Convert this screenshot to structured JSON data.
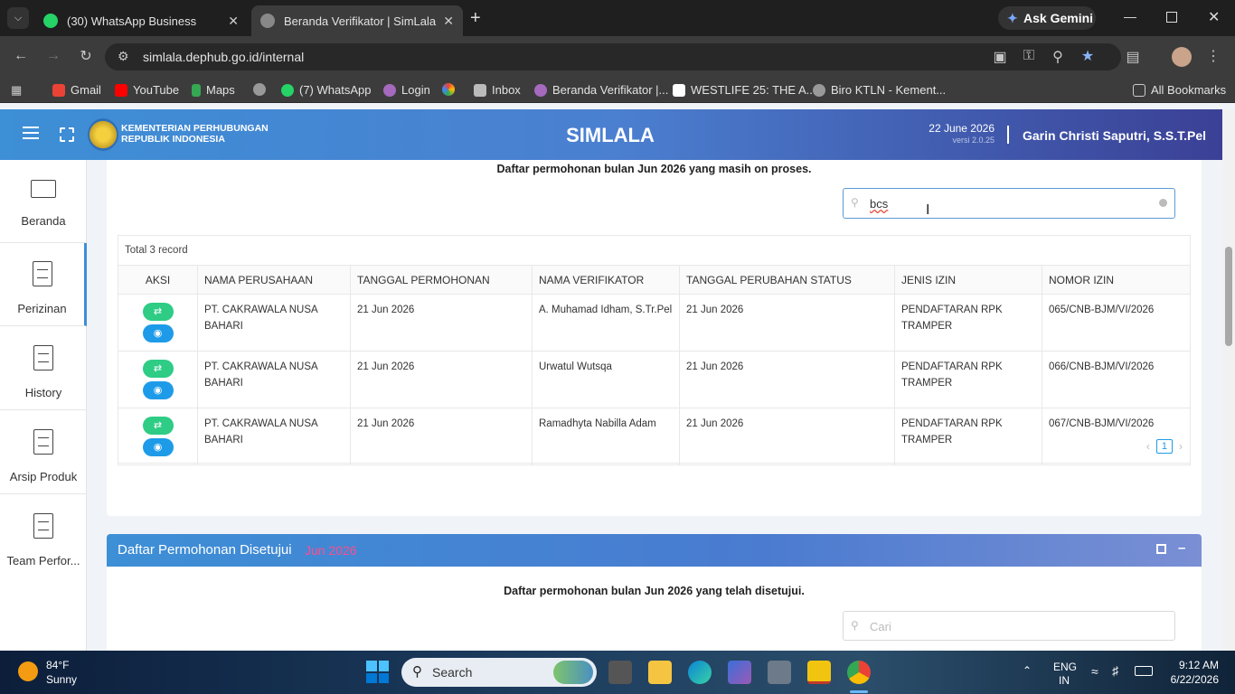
{
  "browser": {
    "tabs": [
      {
        "title": "(30) WhatsApp Business"
      },
      {
        "title": "Beranda Verifikator | SimLala"
      }
    ],
    "url": "simlala.dephub.go.id/internal",
    "ask_gemini": "Ask Gemini",
    "bookmarks": [
      "Gmail",
      "YouTube",
      "Maps",
      "(7) WhatsApp",
      "Login",
      "Inbox",
      "Beranda Verifikator |...",
      "WESTLIFE 25: THE A...",
      "Biro KTLN - Kement..."
    ],
    "all_bookmarks": "All Bookmarks"
  },
  "header": {
    "org_line1": "KEMENTERIAN PERHUBUNGAN",
    "org_line2": "REPUBLIK INDONESIA",
    "app_name": "SIMLALA",
    "date": "22 June 2026",
    "version": "versi 2.0.25",
    "user": "Garin Christi Saputri, S.S.T.Pel"
  },
  "sidebar": {
    "items": [
      {
        "label": "Beranda"
      },
      {
        "label": "Perizinan"
      },
      {
        "label": "History"
      },
      {
        "label": "Arsip Produk"
      },
      {
        "label": "Team Perfor..."
      }
    ]
  },
  "proses": {
    "subtitle": "Daftar permohonan bulan Jun 2026 yang masih on proses.",
    "search_value": "bcs",
    "total": "Total 3 record",
    "columns": [
      "AKSI",
      "NAMA PERUSAHAAN",
      "TANGGAL PERMOHONAN",
      "NAMA VERIFIKATOR",
      "TANGGAL PERUBAHAN STATUS",
      "JENIS IZIN",
      "NOMOR IZIN"
    ],
    "rows": [
      {
        "perusahaan": "PT. CAKRAWALA NUSA BAHARI",
        "tgl_permohonan": "21 Jun 2026",
        "verifikator": "A. Muhamad Idham, S.Tr.Pel",
        "tgl_status": "21 Jun 2026",
        "jenis": "PENDAFTARAN RPK TRAMPER",
        "nomor": "065/CNB-BJM/VI/2026"
      },
      {
        "perusahaan": "PT. CAKRAWALA NUSA BAHARI",
        "tgl_permohonan": "21 Jun 2026",
        "verifikator": "Urwatul Wutsqa",
        "tgl_status": "21 Jun 2026",
        "jenis": "PENDAFTARAN RPK TRAMPER",
        "nomor": "066/CNB-BJM/VI/2026"
      },
      {
        "perusahaan": "PT. CAKRAWALA NUSA BAHARI",
        "tgl_permohonan": "21 Jun 2026",
        "verifikator": "Ramadhyta Nabilla Adam",
        "tgl_status": "21 Jun 2026",
        "jenis": "PENDAFTARAN RPK TRAMPER",
        "nomor": "067/CNB-BJM/VI/2026"
      }
    ],
    "page": "1"
  },
  "disetujui": {
    "title": "Daftar Permohonan Disetujui",
    "title_month": "Jun 2026",
    "subtitle": "Daftar permohonan bulan Jun 2026 yang telah disetujui.",
    "search_placeholder": "Cari"
  },
  "taskbar": {
    "temp": "84°F",
    "weather": "Sunny",
    "search": "Search",
    "lang1": "ENG",
    "lang2": "IN",
    "time": "9:12 AM",
    "date": "6/22/2026"
  }
}
